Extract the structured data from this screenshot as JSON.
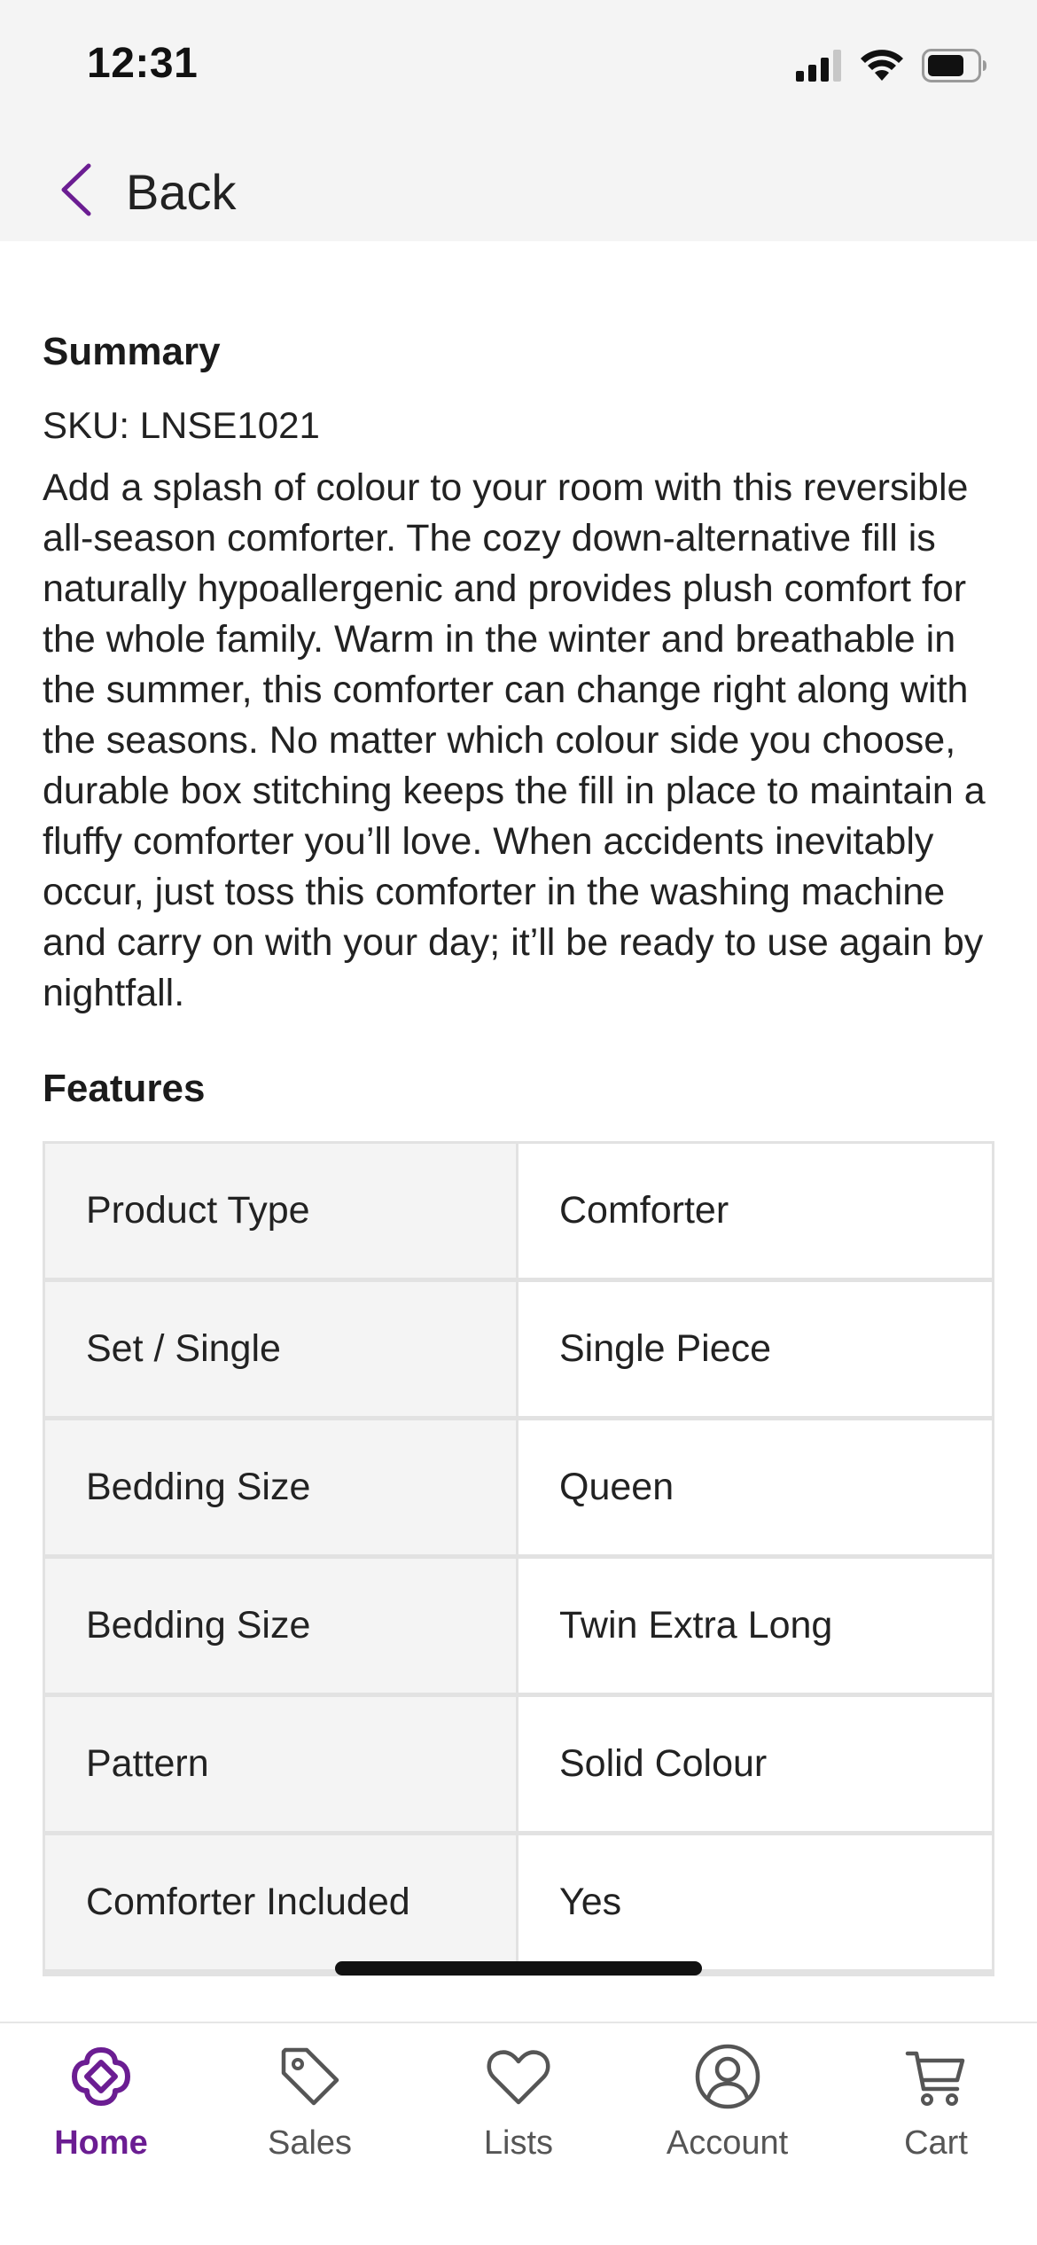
{
  "status_bar": {
    "time": "12:31",
    "icons": [
      "signal-icon",
      "wifi-icon",
      "battery-icon"
    ]
  },
  "nav": {
    "back_label": "Back",
    "back_icon": "chevron-left-icon"
  },
  "summary": {
    "title": "Summary",
    "sku": "SKU: LNSE1021",
    "description": "Add a splash of colour to your room with this reversible all-season comforter. The cozy down-alternative fill is naturally hypoallergenic and provides plush comfort for the whole family. Warm in the winter and breathable in the summer, this comforter can change right along with the seasons. No matter which colour side you choose, durable box stitching keeps the fill in place to maintain a fluffy comforter you’ll love. When accidents inevitably occur, just toss this comforter in the washing machine and carry on with your day; it’ll be ready to use again by nightfall."
  },
  "features": {
    "title": "Features",
    "rows": [
      {
        "label": "Product Type",
        "value": "Comforter"
      },
      {
        "label": "Set / Single",
        "value": "Single Piece"
      },
      {
        "label": "Bedding Size",
        "value": "Queen"
      },
      {
        "label": "Bedding Size",
        "value": "Twin Extra Long"
      },
      {
        "label": "Pattern",
        "value": "Solid Colour"
      },
      {
        "label": "Comforter Included",
        "value": "Yes"
      }
    ]
  },
  "tab_bar": {
    "active": "home",
    "tabs": [
      {
        "id": "home",
        "label": "Home",
        "icon": "home-logo-icon"
      },
      {
        "id": "sales",
        "label": "Sales",
        "icon": "tag-icon"
      },
      {
        "id": "lists",
        "label": "Lists",
        "icon": "heart-icon"
      },
      {
        "id": "account",
        "label": "Account",
        "icon": "account-icon"
      },
      {
        "id": "cart",
        "label": "Cart",
        "icon": "cart-icon"
      }
    ]
  },
  "colors": {
    "accent": "#6b1d92",
    "header_bg": "#f4f4f4",
    "table_border": "#e2e2e2",
    "label_cell_bg": "#f4f4f4"
  }
}
